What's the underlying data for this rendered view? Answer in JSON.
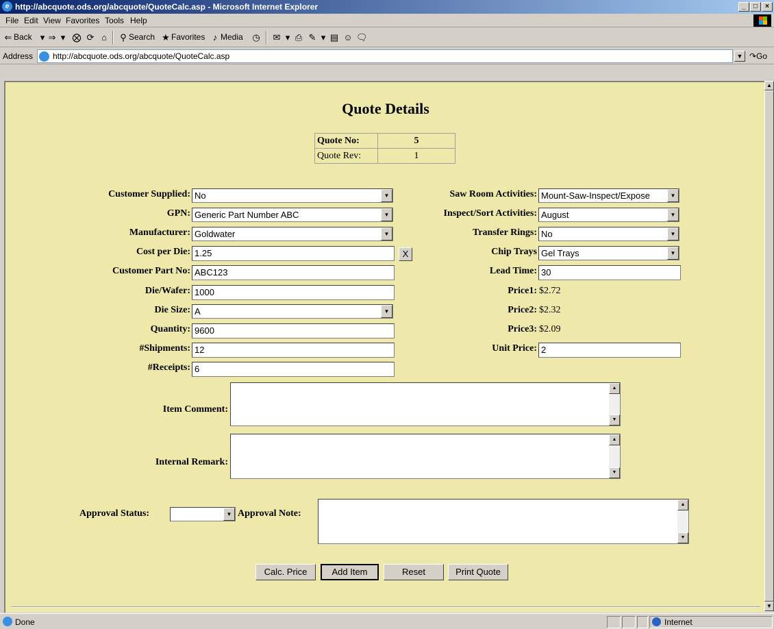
{
  "window": {
    "title": "http://abcquote.ods.org/abcquote/QuoteCalc.asp - Microsoft Internet Explorer"
  },
  "menu": [
    "File",
    "Edit",
    "View",
    "Favorites",
    "Tools",
    "Help"
  ],
  "toolbar": {
    "back": "Back",
    "search": "Search",
    "favorites": "Favorites",
    "media": "Media"
  },
  "address": {
    "label": "Address",
    "url": "http://abcquote.ods.org/abcquote/QuoteCalc.asp",
    "go": "Go"
  },
  "page": {
    "title": "Quote Details",
    "quote_no_label": "Quote No:",
    "quote_no": "5",
    "quote_rev_label": "Quote Rev:",
    "quote_rev": "1"
  },
  "left_fields": {
    "customer_supplied": {
      "label": "Customer Supplied:",
      "value": "No"
    },
    "gpn": {
      "label": "GPN:",
      "value": "Generic Part Number ABC"
    },
    "manufacturer": {
      "label": "Manufacturer:",
      "value": "Goldwater"
    },
    "cost_per_die": {
      "label": "Cost per Die:",
      "value": "1.25",
      "clear": "X"
    },
    "customer_part_no": {
      "label": "Customer Part No:",
      "value": "ABC123"
    },
    "die_wafer": {
      "label": "Die/Wafer:",
      "value": "1000"
    },
    "die_size": {
      "label": "Die Size:",
      "value": "A"
    },
    "quantity": {
      "label": "Quantity:",
      "value": "9600"
    },
    "shipments": {
      "label": "#Shipments:",
      "value": "12"
    },
    "receipts": {
      "label": "#Receipts:",
      "value": "6"
    }
  },
  "right_fields": {
    "saw_room": {
      "label": "Saw Room Activities:",
      "value": "Mount-Saw-Inspect/Expose"
    },
    "inspect_sort": {
      "label": "Inspect/Sort Activities:",
      "value": "August"
    },
    "transfer_rings": {
      "label": "Transfer Rings:",
      "value": "No"
    },
    "chip_trays": {
      "label": "Chip Trays",
      "value": "Gel Trays"
    },
    "lead_time": {
      "label": "Lead Time:",
      "value": "30"
    },
    "price1": {
      "label": "Price1:",
      "value": "$2.72"
    },
    "price2": {
      "label": "Price2:",
      "value": "$2.32"
    },
    "price3": {
      "label": "Price3:",
      "value": "$2.09"
    },
    "unit_price": {
      "label": "Unit Price:",
      "value": "2"
    }
  },
  "comments": {
    "item_comment_label": "Item Comment:",
    "internal_remark_label": "Internal Remark:",
    "approval_status_label": "Approval Status:",
    "approval_status_value": "",
    "approval_note_label": "Approval Note:"
  },
  "buttons": {
    "calc": "Calc. Price",
    "add": "Add Item",
    "reset": "Reset",
    "print": "Print Quote"
  },
  "status": {
    "text": "Done",
    "zone": "Internet"
  },
  "colors": {
    "page_bg": "#eee8aa",
    "titlebar_start": "#0a246a",
    "chrome": "#d4d0c8"
  }
}
